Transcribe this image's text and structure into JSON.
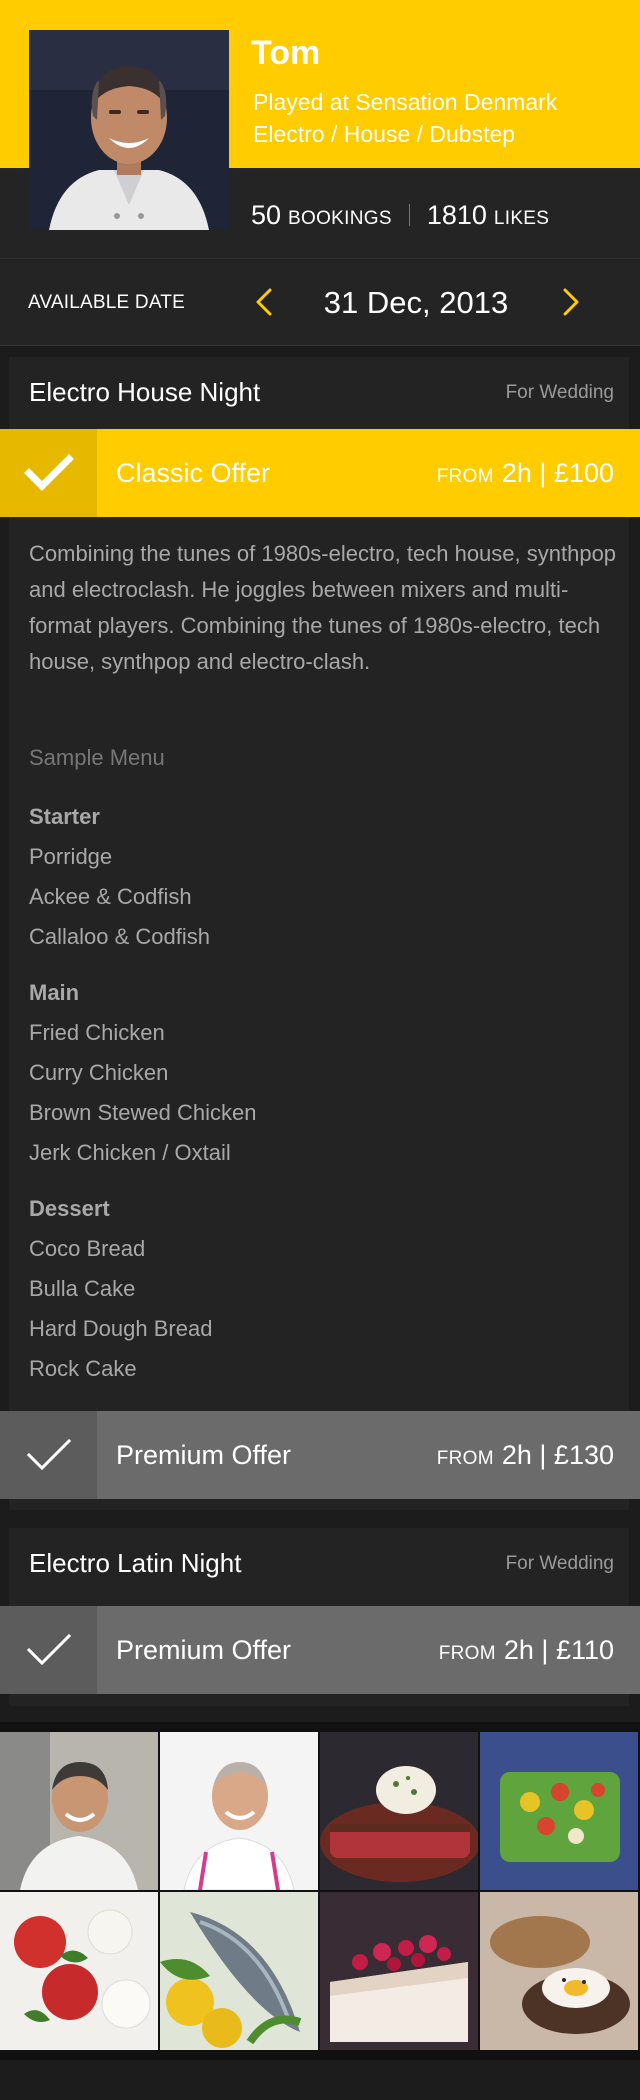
{
  "profile": {
    "name": "Tom",
    "played_at": "Played at Sensation Denmark",
    "genres": "Electro / House / Dubstep",
    "bookings_count": "50",
    "bookings_label": "BOOKINGS",
    "likes_count": "1810",
    "likes_label": "LIKES"
  },
  "date_selector": {
    "label": "AVAILABLE DATE",
    "value": "31 Dec, 2013",
    "prev_icon": "chevron-left-icon",
    "next_icon": "chevron-right-icon"
  },
  "colors": {
    "accent": "#ffcc00",
    "background": "#1c1c1c",
    "card": "#232323",
    "muted_offer": "#6b6b6b"
  },
  "events": [
    {
      "title": "Electro House Night",
      "tag": "For Wedding",
      "offers": [
        {
          "label": "Classic Offer",
          "from": "FROM",
          "price": "2h | £100",
          "selected": true
        },
        {
          "label": "Premium Offer",
          "from": "FROM",
          "price": "2h | £130",
          "selected": false
        }
      ],
      "description": "Combining the tunes of 1980s-electro, tech house, synthpop and electroclash. He joggles between mixers and multi-format players. Combining the tunes of 1980s-electro, tech house, synthpop and electro-clash.",
      "menu_title": "Sample Menu",
      "menu": [
        {
          "section": "Starter",
          "items": [
            "Porridge",
            "Ackee & Codfish",
            "Callaloo & Codfish"
          ]
        },
        {
          "section": "Main",
          "items": [
            "Fried Chicken",
            "Curry Chicken",
            "Brown Stewed Chicken",
            "Jerk Chicken / Oxtail"
          ]
        },
        {
          "section": "Dessert",
          "items": [
            "Coco Bread",
            "Bulla Cake",
            "Hard Dough Bread",
            "Rock Cake"
          ]
        }
      ]
    },
    {
      "title": "Electro Latin Night",
      "tag": "For Wedding",
      "offers": [
        {
          "label": "Premium Offer",
          "from": "FROM",
          "price": "2h | £110",
          "selected": false
        }
      ]
    }
  ],
  "gallery": [
    {
      "subject": "chef-portrait"
    },
    {
      "subject": "chef-portrait"
    },
    {
      "subject": "steak-dish"
    },
    {
      "subject": "salad-dish"
    },
    {
      "subject": "caprese-dish"
    },
    {
      "subject": "fish-dish"
    },
    {
      "subject": "berry-cake"
    },
    {
      "subject": "burger-dish"
    }
  ]
}
